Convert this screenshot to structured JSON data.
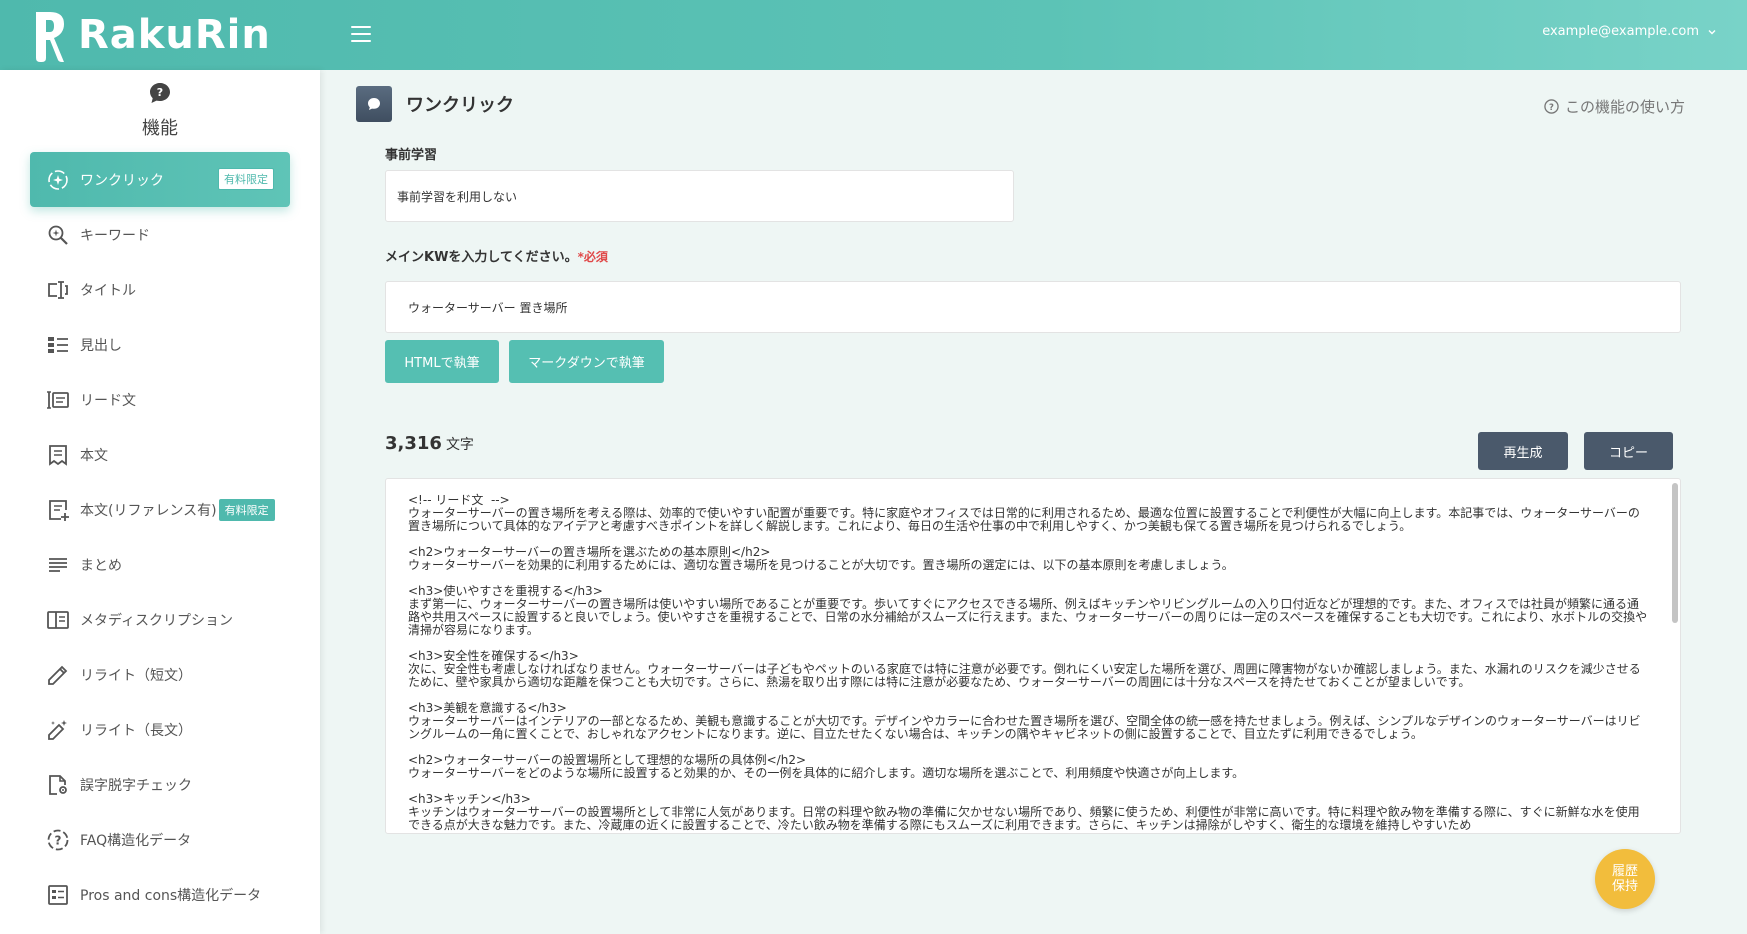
{
  "header": {
    "logo_text": "RakuRin",
    "user_email": "example@example.com"
  },
  "sidebar": {
    "title": "機能",
    "items": [
      {
        "label": "ワンクリック",
        "badge": "有料限定",
        "icon": "sparkle-circle-icon",
        "active": true
      },
      {
        "label": "キーワード",
        "icon": "search-sparkle-icon"
      },
      {
        "label": "タイトル",
        "icon": "title-cursor-icon"
      },
      {
        "label": "見出し",
        "icon": "list-heading-icon"
      },
      {
        "label": "リード文",
        "icon": "lead-text-icon"
      },
      {
        "label": "本文",
        "icon": "document-icon"
      },
      {
        "label": "本文(リファレンス有)",
        "badge": "有料限定",
        "icon": "document-plus-icon"
      },
      {
        "label": "まとめ",
        "icon": "lines-icon"
      },
      {
        "label": "メタディスクリプション",
        "icon": "panel-icon"
      },
      {
        "label": "リライト（短文）",
        "icon": "pencil-icon"
      },
      {
        "label": "リライト（長文）",
        "icon": "pencil-sparkle-icon"
      },
      {
        "label": "誤字脱字チェック",
        "icon": "file-search-icon"
      },
      {
        "label": "FAQ構造化データ",
        "icon": "question-circle-icon"
      },
      {
        "label": "Pros and cons構造化データ",
        "icon": "checklist-icon"
      }
    ]
  },
  "main": {
    "page_title": "ワンクリック",
    "howto_label": "この機能の使い方",
    "prelearn_label": "事前学習",
    "prelearn_value": "事前学習を利用しない",
    "kw_label": "メインKWを入力してください。",
    "kw_required": "*必須",
    "kw_value": "ウォーターサーバー 置き場所",
    "btn_html": "HTMLで執筆",
    "btn_markdown": "マークダウンで執筆",
    "char_count": "3,316",
    "char_unit": "文字",
    "btn_regen": "再生成",
    "btn_copy": "コピー",
    "output_text": "<!-- リード文  -->\nウォーターサーバーの置き場所を考える際は、効率的で使いやすい配置が重要です。特に家庭やオフィスでは日常的に利用されるため、最適な位置に設置することで利便性が大幅に向上します。本記事では、ウォーターサーバーの置き場所について具体的なアイデアと考慮すべきポイントを詳しく解説します。これにより、毎日の生活や仕事の中で利用しやすく、かつ美観も保てる置き場所を見つけられるでしょう。\n\n<h2>ウォーターサーバーの置き場所を選ぶための基本原則</h2>\nウォーターサーバーを効果的に利用するためには、適切な置き場所を見つけることが大切です。置き場所の選定には、以下の基本原則を考慮しましょう。\n\n<h3>使いやすさを重視する</h3>\nまず第一に、ウォーターサーバーの置き場所は使いやすい場所であることが重要です。歩いてすぐにアクセスできる場所、例えばキッチンやリビングルームの入り口付近などが理想的です。また、オフィスでは社員が頻繁に通る通路や共用スペースに設置すると良いでしょう。使いやすさを重視することで、日常の水分補給がスムーズに行えます。また、ウォーターサーバーの周りには一定のスペースを確保することも大切です。これにより、水ボトルの交換や清掃が容易になります。\n\n<h3>安全性を確保する</h3>\n次に、安全性も考慮しなければなりません。ウォーターサーバーは子どもやペットのいる家庭では特に注意が必要です。倒れにくい安定した場所を選び、周囲に障害物がないか確認しましょう。また、水漏れのリスクを減少させるために、壁や家具から適切な距離を保つことも大切です。さらに、熱湯を取り出す際には特に注意が必要なため、ウォーターサーバーの周囲には十分なスペースを持たせておくことが望ましいです。\n\n<h3>美観を意識する</h3>\nウォーターサーバーはインテリアの一部となるため、美観も意識することが大切です。デザインやカラーに合わせた置き場所を選び、空間全体の統一感を持たせましょう。例えば、シンプルなデザインのウォーターサーバーはリビングルームの一角に置くことで、おしゃれなアクセントになります。逆に、目立たせたくない場合は、キッチンの隅やキャビネットの側に設置することで、目立たずに利用できるでしょう。\n\n<h2>ウォーターサーバーの設置場所として理想的な場所の具体例</h2>\nウォーターサーバーをどのような場所に設置すると効果的か、その一例を具体的に紹介します。適切な場所を選ぶことで、利用頻度や快適さが向上します。\n\n<h3>キッチン</h3>\nキッチンはウォーターサーバーの設置場所として非常に人気があります。日常の料理や飲み物の準備に欠かせない場所であり、頻繁に使うため、利便性が非常に高いです。特に料理や飲み物を準備する際に、すぐに新鮮な水を使用できる点が大きな魅力です。また、冷蔵庫の近くに設置することで、冷たい飲み物を準備する際にもスムーズに利用できます。さらに、キッチンは掃除がしやすく、衛生的な環境を維持しやすいため",
    "fab_label": "履歴保持"
  },
  "colors": {
    "accent": "#4fb9ad",
    "dark_button": "#4a596b",
    "fab": "#f2bd3c",
    "required": "#e04848"
  }
}
